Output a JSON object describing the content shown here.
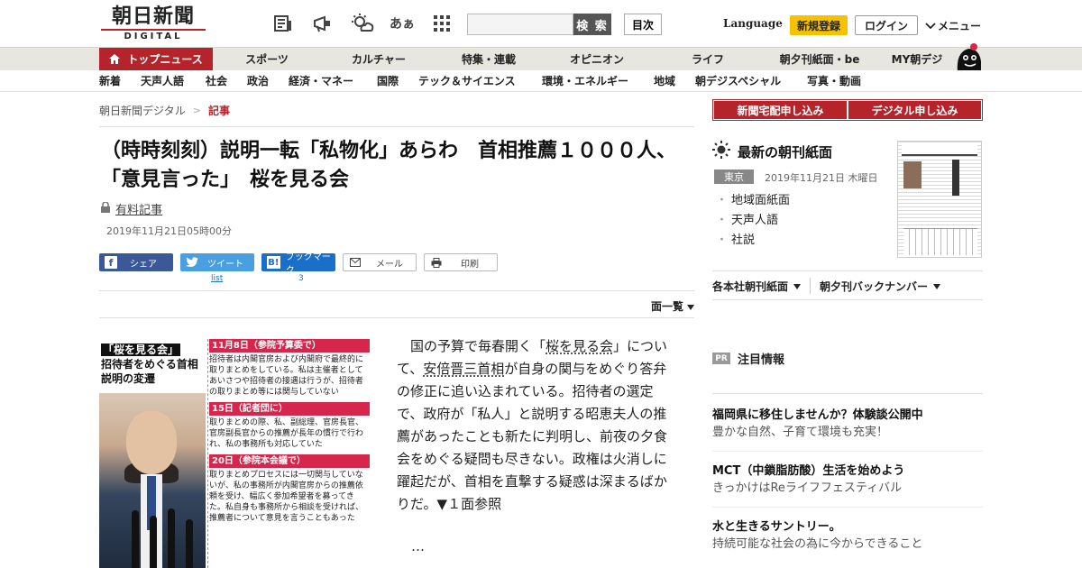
{
  "header": {
    "logo_main": "朝日新聞",
    "logo_sub": "DIGITAL",
    "search_button": "検 索",
    "toc_button": "目次",
    "language": "Language",
    "signup": "新規登録",
    "login": "ログイン",
    "menu": "メニュー",
    "icon_hiragana": "あぁ"
  },
  "nav_main": [
    "トップニュース",
    "スポーツ",
    "カルチャー",
    "特集・連載",
    "オピニオン",
    "ライフ",
    "朝夕刊紙面・be",
    "MY朝デジ"
  ],
  "nav_sub": [
    "新着",
    "天声人語",
    "社会",
    "政治",
    "経済・マネー",
    "国際",
    "テック＆サイエンス",
    "環境・エネルギー",
    "地域",
    "朝デジスペシャル",
    "写真・動画"
  ],
  "breadcrumb": {
    "home": "朝日新聞デジタル",
    "sep": ">",
    "current": "記事"
  },
  "article": {
    "title": "（時時刻刻）説明一転「私物化」あらわ　首相推薦１０００人、「意見言った」　桜を見る会",
    "paid_label": "有料記事",
    "date": "2019年11月21日05時00分",
    "share": {
      "facebook": "シェア",
      "twitter": "ツイート",
      "hatena": "ブックマーク",
      "mail": "メール",
      "print": "印刷"
    },
    "twitter_count": "list",
    "hatena_count": "3",
    "page_list": "面一覧",
    "body_pre": "　国の予算で毎春開く「",
    "body_link1": "桜を見る会",
    "body_mid1": "」について、",
    "body_link2": "安倍晋三首相",
    "body_post": "が自身の関与をめぐり答弁の修正に追い込まれている。招待者の選定で、政府が「私人」と説明する昭恵夫人の推薦があったことも新たに判明し、前夜の夕食会をめぐる疑問も尽きない。政権は火消しに躍起だが、首相を直撃する疑惑は深まるばかりだ。▼１面参照",
    "ellipsis": "…"
  },
  "figure": {
    "title_hl": "「桜を見る会」",
    "title_rest": "招待者をめぐる首相説明の変遷",
    "sections": [
      {
        "head": "11月8日（参院予算委で）",
        "body": "招待者は内閣官房および内閣府で最終的に取りまとめをしている。私は主催者としてあいさつや招待者の接遇は行うが、招待者の取りまとめ等には関与していない"
      },
      {
        "head": "15日（記者団に）",
        "body": "取りまとめの際、私、副総理、官房長官、官房副長官からの推薦が長年の慣行で行われ、私の事務所も対応していた"
      },
      {
        "head": "20日（参院本会議で）",
        "body": "取りまとめプロセスには一切関与していないが、私の事務所が内閣官房からの推薦依頼を受け、幅広く参加希望者を募ってきた。私自身も事務所から相談を受ければ、推薦者について意見を言うこともあった"
      }
    ]
  },
  "sidebar": {
    "subscribe_paper": "新聞宅配申し込み",
    "subscribe_digital": "デジタル申し込み",
    "paper_heading": "最新の朝刊紙面",
    "city": "東京",
    "paper_date": "2019年11月21日 木曜日",
    "paper_links": [
      "地域面紙面",
      "天声人語",
      "社説"
    ],
    "link_branch": "各本社朝刊紙面",
    "link_backnumber": "朝夕刊バックナンバー",
    "pr_badge": "PR",
    "pr_heading": "注目情報",
    "promos": [
      {
        "headline": "福岡県に移住しませんか？体験談公開中",
        "sub": "豊かな自然、子育て環境も充実！"
      },
      {
        "headline": "MCT（中鎖脂肪酸）生活を始めよう",
        "sub": "きっかけはReライフフェスティバル"
      },
      {
        "headline": "水と生きるサントリー。",
        "sub": "持続可能な社会の為に今からできること"
      }
    ]
  },
  "colors": {
    "brand_red": "#b5232b",
    "signup_yellow": "#f5c200",
    "facebook": "#3b5998",
    "twitter": "#4a9fe0",
    "hatena": "#1a6fc8"
  }
}
